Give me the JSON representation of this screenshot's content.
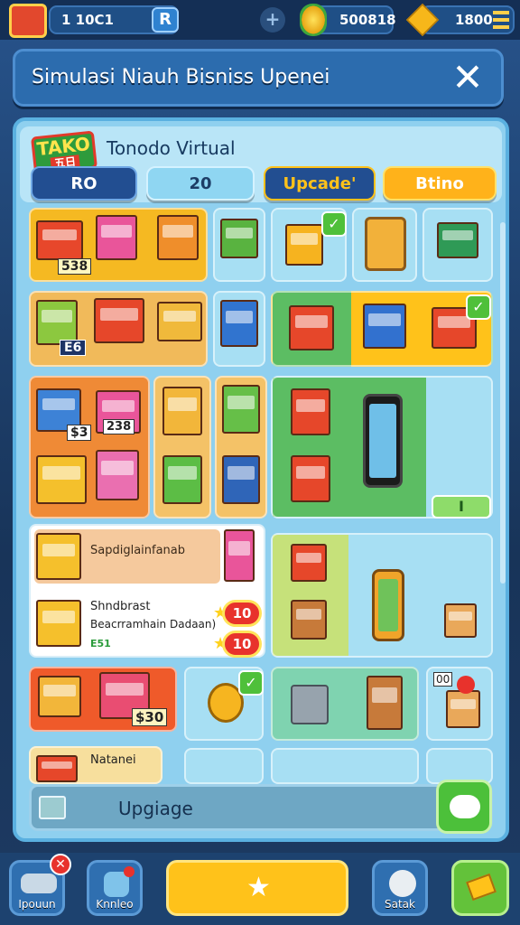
{
  "topbar": {
    "resource_1": "1 10C1",
    "resource_2": "500818",
    "resource_3": "1800",
    "plus": "+",
    "r_button": "R"
  },
  "header": {
    "title": "Simulasi Niauh Bisniss Upenei",
    "close": "✕"
  },
  "panel": {
    "logo_top": "TAKO",
    "logo_bottom": "五日",
    "brand": "Tonodo Virtual",
    "tabs": [
      "RO",
      "20",
      "Upcade'",
      "Btino"
    ]
  },
  "items": {
    "price_1": "538",
    "price_2": "E6",
    "price_3": "$3",
    "price_4": "238",
    "mini_btn": "I",
    "card_title": "Sapdiglainfanab",
    "card_line1": "Shndbrast",
    "card_line2": "Beacrramhain Dadaan)",
    "card_small": "E51",
    "card_badge1": "10",
    "card_badge2": "10",
    "price_5": "$30",
    "tag_zero": "00",
    "note": "Natanei"
  },
  "upgrade": {
    "label": "Upgiage"
  },
  "bottom_nav": [
    "Ipouun",
    "Knnleo",
    "Satak"
  ],
  "colors": {
    "accent_yellow": "#ffc21a",
    "accent_green": "#4cc03a",
    "panel_blue": "#8fd0ef",
    "badge_red": "#e8322c"
  }
}
